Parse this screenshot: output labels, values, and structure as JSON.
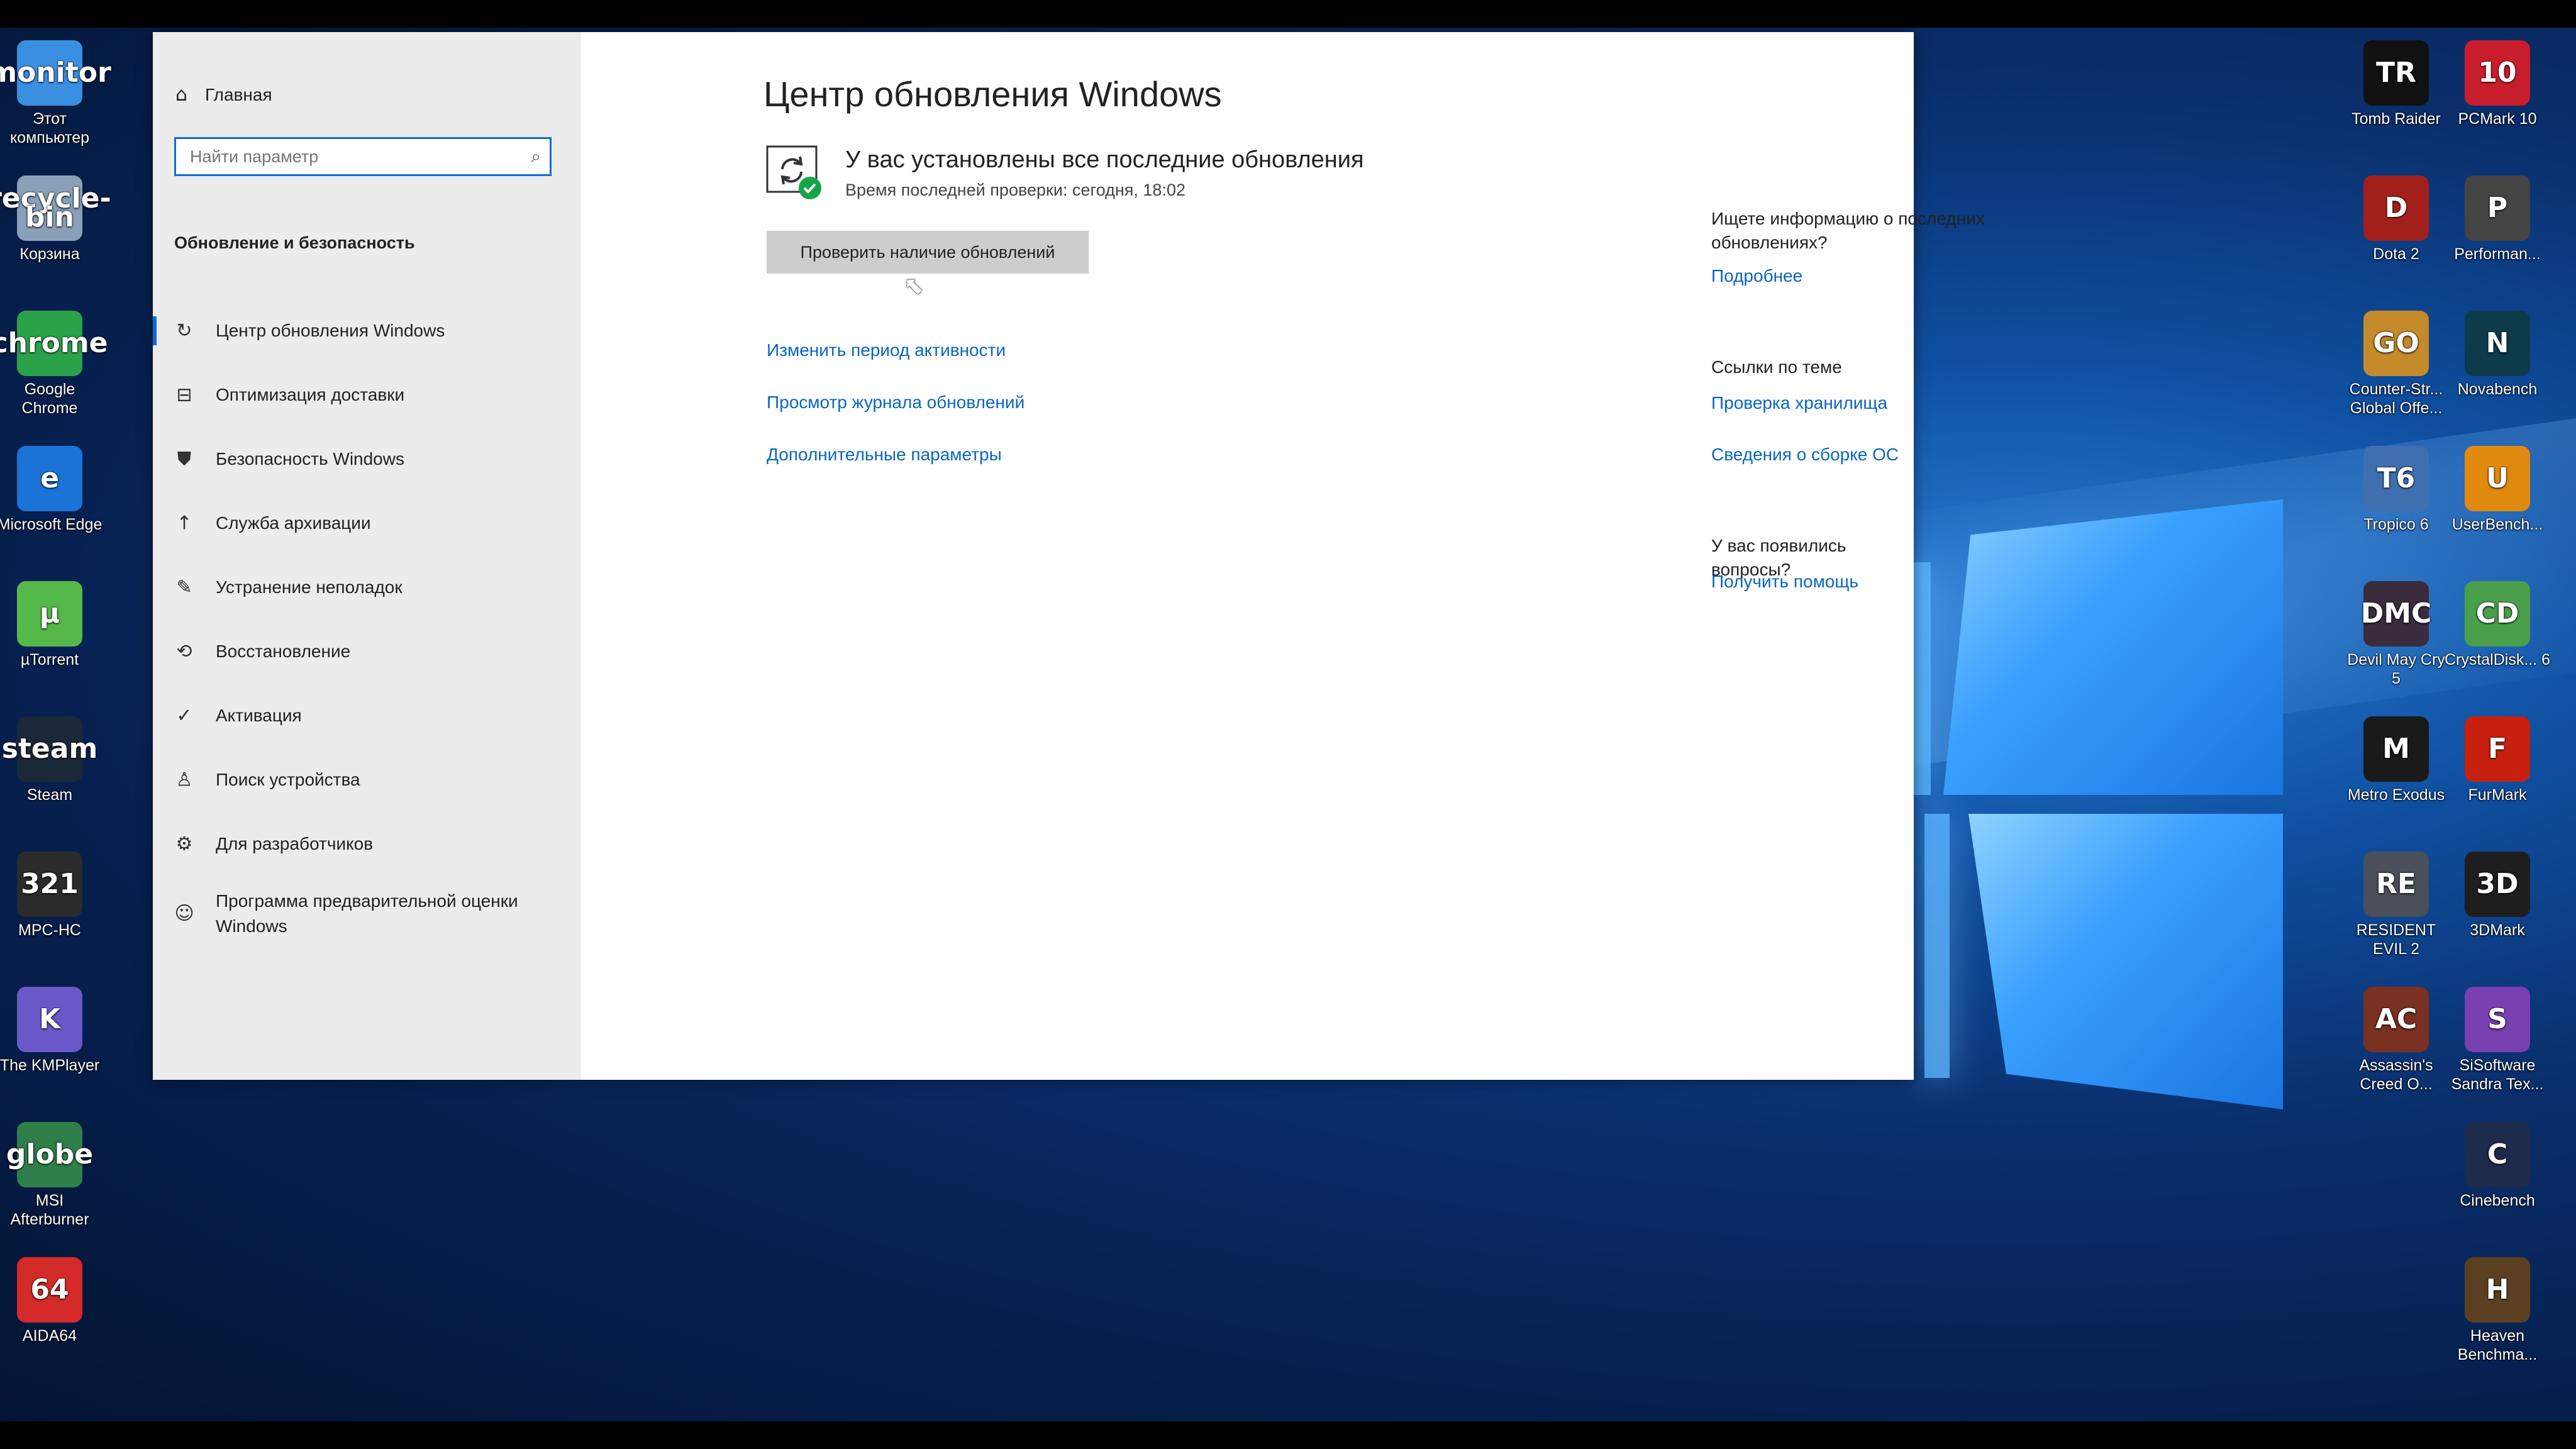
{
  "desktop": {
    "left_icons": [
      {
        "name": "this-pc",
        "label": "Этот компьютер",
        "icon": "monitor",
        "color": "#3b8fe0"
      },
      {
        "name": "recycle-bin",
        "label": "Корзина",
        "icon": "recycle-bin",
        "color": "#8aa0b8"
      },
      {
        "name": "chrome",
        "label": "Google Chrome",
        "icon": "chrome",
        "color": "#2aa24a"
      },
      {
        "name": "edge",
        "label": "Microsoft Edge",
        "icon": "e",
        "color": "#1b73d6"
      },
      {
        "name": "utorrent",
        "label": "µTorrent",
        "icon": "µ",
        "color": "#54b948"
      },
      {
        "name": "steam",
        "label": "Steam",
        "icon": "steam",
        "color": "#1b2838"
      },
      {
        "name": "mpc-hc",
        "label": "MPC-HC",
        "icon": "321",
        "color": "#2b2b2b"
      },
      {
        "name": "kmplayer",
        "label": "The KMPlayer",
        "icon": "K",
        "color": "#6a58c9"
      },
      {
        "name": "msi-afterburner",
        "label": "MSI Afterburner",
        "icon": "globe",
        "color": "#2f7f4a"
      },
      {
        "name": "aida64",
        "label": "AIDA64",
        "icon": "64",
        "color": "#d42a2a"
      }
    ],
    "right_col1": [
      {
        "name": "tomb-raider",
        "label": "Tomb Raider",
        "icon": "TR",
        "color": "#111111"
      },
      {
        "name": "dota2",
        "label": "Dota 2",
        "icon": "D",
        "color": "#a3201a"
      },
      {
        "name": "csgo",
        "label": "Counter-Str... Global Offe...",
        "icon": "GO",
        "color": "#c58a2a"
      },
      {
        "name": "tropico6",
        "label": "Tropico 6",
        "icon": "T6",
        "color": "#3f6fae"
      },
      {
        "name": "devil-may-cry5",
        "label": "Devil May Cry 5",
        "icon": "DMC",
        "color": "#3a2b3d"
      },
      {
        "name": "metro-exodus",
        "label": "Metro Exodus",
        "icon": "M",
        "color": "#1a1a1a"
      },
      {
        "name": "resident-evil2",
        "label": "RESIDENT EVIL 2",
        "icon": "RE",
        "color": "#4a4f5a"
      },
      {
        "name": "assassins-creed",
        "label": "Assassin's Creed O...",
        "icon": "AC",
        "color": "#7a3020"
      }
    ],
    "right_col2": [
      {
        "name": "pcmark10",
        "label": "PCMark 10",
        "icon": "10",
        "color": "#c81e2c"
      },
      {
        "name": "performance",
        "label": "Performan...",
        "icon": "P",
        "color": "#444444"
      },
      {
        "name": "novabench",
        "label": "Novabench",
        "icon": "N",
        "color": "#0d3b4a"
      },
      {
        "name": "userbench",
        "label": "UserBench...",
        "icon": "U",
        "color": "#e08a10"
      },
      {
        "name": "crystaldisk",
        "label": "CrystalDisk... 6",
        "icon": "CD",
        "color": "#4aa04a"
      },
      {
        "name": "furmark",
        "label": "FurMark",
        "icon": "F",
        "color": "#c8200e"
      },
      {
        "name": "3dmark",
        "label": "3DMark",
        "icon": "3D",
        "color": "#1e1e1e"
      },
      {
        "name": "sisoftware",
        "label": "SiSoftware Sandra Tex...",
        "icon": "S",
        "color": "#7a3fb0"
      },
      {
        "name": "cinebench",
        "label": "Cinebench",
        "icon": "C",
        "color": "#1d2a4a"
      },
      {
        "name": "heaven",
        "label": "Heaven Benchma...",
        "icon": "H",
        "color": "#5a4020"
      }
    ]
  },
  "sidebar": {
    "home_label": "Главная",
    "search_placeholder": "Найти параметр",
    "section_title": "Обновление и безопасность",
    "items": [
      {
        "label": "Центр обновления Windows",
        "icon": "↻",
        "active": true
      },
      {
        "label": "Оптимизация доставки",
        "icon": "⊟"
      },
      {
        "label": "Безопасность Windows",
        "icon": "⛊"
      },
      {
        "label": "Служба архивации",
        "icon": "↑"
      },
      {
        "label": "Устранение неполадок",
        "icon": "✎"
      },
      {
        "label": "Восстановление",
        "icon": "⟲"
      },
      {
        "label": "Активация",
        "icon": "✓"
      },
      {
        "label": "Поиск устройства",
        "icon": "♙"
      },
      {
        "label": "Для разработчиков",
        "icon": "⚙"
      },
      {
        "label": "Программа предварительной оценки Windows",
        "icon": "☺"
      }
    ]
  },
  "main": {
    "title": "Центр обновления Windows",
    "status_title": "У вас установлены все последние обновления",
    "status_subtitle": "Время последней проверки: сегодня, 18:02",
    "check_button": "Проверить наличие обновлений",
    "links": [
      "Изменить период активности",
      "Просмотр журнала обновлений",
      "Дополнительные параметры"
    ]
  },
  "right_panel": {
    "info_question": "Ищете информацию о последних обновлениях?",
    "info_link": "Подробнее",
    "related_title": "Ссылки по теме",
    "related_links": [
      "Проверка хранилища",
      "Сведения о сборке ОС"
    ],
    "help_question": "У вас появились вопросы?",
    "help_link": "Получить помощь"
  }
}
